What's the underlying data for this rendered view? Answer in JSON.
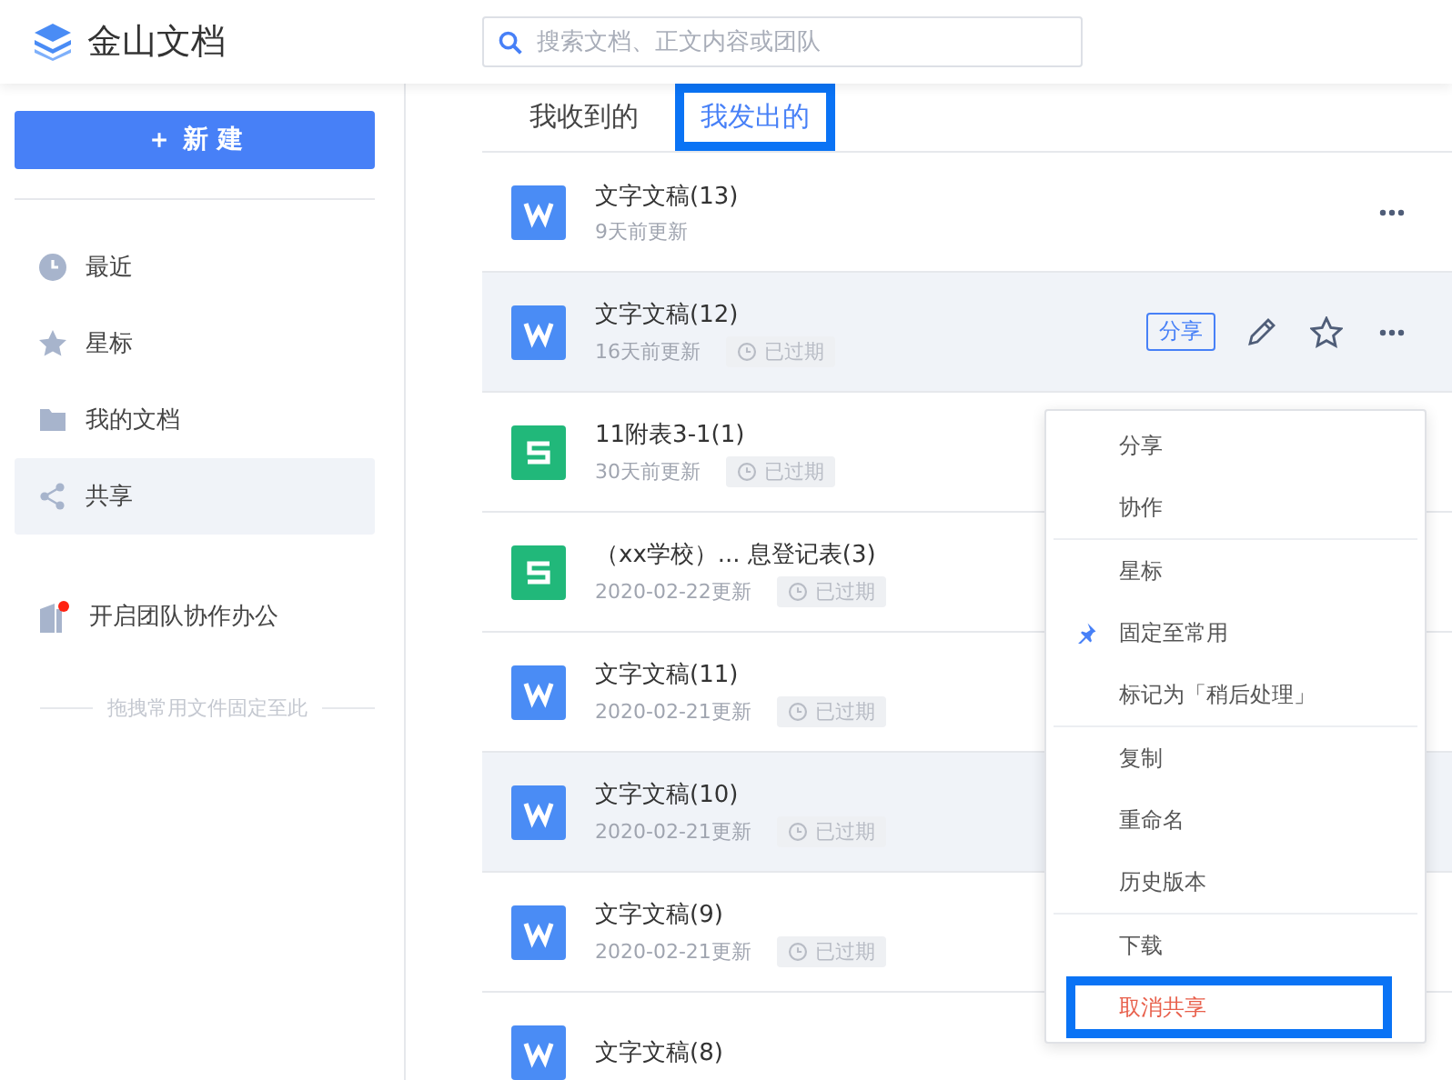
{
  "header": {
    "title": "金山文档",
    "search": {
      "placeholder": "搜索文档、正文内容或团队"
    }
  },
  "sidebar": {
    "new_button": {
      "icon": "＋",
      "label": "新 建"
    },
    "items": [
      {
        "label": "最近",
        "selected": false
      },
      {
        "label": "星标",
        "selected": false
      },
      {
        "label": "我的文档",
        "selected": false
      },
      {
        "label": "共享",
        "selected": true
      }
    ],
    "team": {
      "label": "开启团队协作办公",
      "notification": true
    },
    "pin_hint": "拖拽常用文件固定至此"
  },
  "tabs": [
    {
      "label": "我收到的",
      "selected": false,
      "highlighted": false
    },
    {
      "label": "我发出的",
      "selected": true,
      "highlighted": true
    }
  ],
  "files": [
    {
      "kind": "doc",
      "name": "文字文稿(13)",
      "updated": "9天前更新",
      "highlighted": false,
      "more_button": true,
      "hover_actions": false
    },
    {
      "kind": "doc",
      "name": "文字文稿(12)",
      "updated": "16天前更新",
      "expired": "已过期",
      "highlighted": true,
      "more_button": true,
      "hover_actions": true,
      "share_label": "分享"
    },
    {
      "kind": "sheet",
      "name": "11附表3-1(1)",
      "updated": "30天前更新",
      "expired": "已过期",
      "highlighted": false
    },
    {
      "kind": "sheet",
      "name": "（xx学校）... 息登记表(3)",
      "updated": "2020-02-22更新",
      "expired": "已过期",
      "highlighted": false
    },
    {
      "kind": "doc",
      "name": "文字文稿(11)",
      "updated": "2020-02-21更新",
      "expired": "已过期",
      "highlighted": false
    },
    {
      "kind": "doc",
      "name": "文字文稿(10)",
      "updated": "2020-02-21更新",
      "expired": "已过期",
      "highlighted": true
    },
    {
      "kind": "doc",
      "name": "文字文稿(9)",
      "updated": "2020-02-21更新",
      "expired": "已过期",
      "highlighted": false
    },
    {
      "kind": "doc",
      "name": "文字文稿(8)",
      "highlighted": false
    }
  ],
  "context_menu": {
    "groups": [
      [
        {
          "kind": "plain",
          "label": "分享",
          "danger": false,
          "highlighted": false
        },
        {
          "kind": "plain",
          "label": "协作",
          "danger": false,
          "highlighted": false
        }
      ],
      [
        {
          "kind": "plain",
          "label": "星标",
          "danger": false,
          "highlighted": false
        },
        {
          "kind": "pin",
          "label": "固定至常用",
          "danger": false,
          "highlighted": false
        },
        {
          "kind": "plain",
          "label": "标记为「稍后处理」",
          "danger": false,
          "highlighted": false
        }
      ],
      [
        {
          "kind": "plain",
          "label": "复制",
          "danger": false,
          "highlighted": false
        },
        {
          "kind": "plain",
          "label": "重命名",
          "danger": false,
          "highlighted": false
        },
        {
          "kind": "plain",
          "label": "历史版本",
          "danger": false,
          "highlighted": false
        }
      ],
      [
        {
          "kind": "plain",
          "label": "下载",
          "danger": false,
          "highlighted": false
        },
        {
          "kind": "plain",
          "label": "取消共享",
          "danger": true,
          "highlighted": true
        }
      ]
    ]
  }
}
